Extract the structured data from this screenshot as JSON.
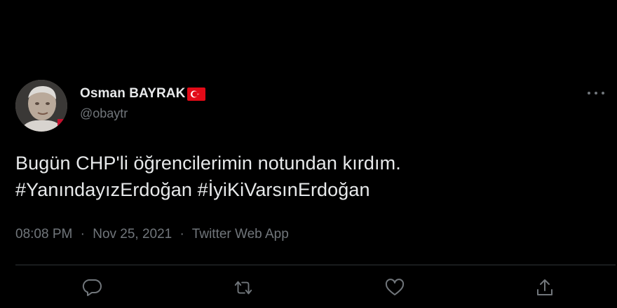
{
  "tweet": {
    "display_name": "Osman BAYRAK",
    "handle": "@obaytr",
    "flag_icon": "turkey-flag-icon",
    "text_lines": [
      "Bugün CHP'li öğrencilerimin notundan kırdım.",
      "#YanındayızErdoğan #İyiKiVarsınErdoğan"
    ],
    "time": "08:08 PM",
    "date": "Nov 25, 2021",
    "source": "Twitter Web App",
    "separator": "·"
  },
  "icons": {
    "more": "more-options-icon",
    "reply": "reply-icon",
    "retweet": "retweet-icon",
    "like": "like-icon",
    "share": "share-icon"
  },
  "colors": {
    "background": "#000000",
    "text_primary": "#e7e9ea",
    "text_secondary": "#71767b",
    "divider": "#2f3336",
    "flag_red": "#e30a17"
  }
}
